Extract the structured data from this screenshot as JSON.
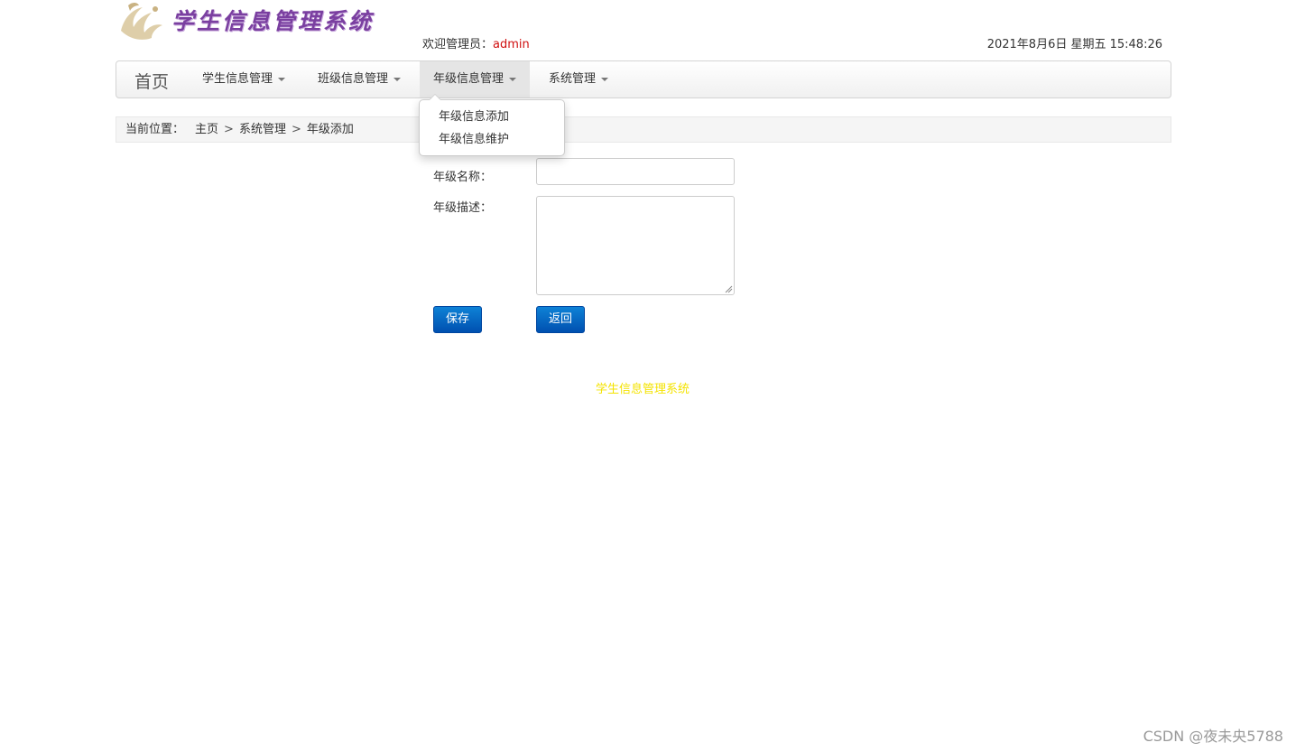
{
  "header": {
    "logo_text": "学生信息管理系统",
    "welcome_label": "欢迎管理员：",
    "welcome_user": "admin",
    "datetime": "2021年8月6日 星期五 15:48:26"
  },
  "navbar": {
    "brand": "首页",
    "items": [
      {
        "label": "学生信息管理"
      },
      {
        "label": "班级信息管理"
      },
      {
        "label": "年级信息管理"
      },
      {
        "label": "系统管理"
      }
    ],
    "active_index": 2
  },
  "dropdown": {
    "items": [
      {
        "label": "年级信息添加"
      },
      {
        "label": "年级信息维护"
      }
    ]
  },
  "breadcrumb": {
    "label": "当前位置：",
    "items": [
      "主页",
      "系统管理",
      "年级添加"
    ],
    "separator": ">"
  },
  "form": {
    "name_label": "年级名称：",
    "name_value": "",
    "desc_label": "年级描述：",
    "desc_value": "",
    "save_label": "保存",
    "back_label": "返回"
  },
  "footer": {
    "text": "学生信息管理系统"
  },
  "watermark": "CSDN @夜未央5788",
  "colors": {
    "accent_blue": "#0050b0",
    "username_red": "#d01010",
    "footer_yellow": "#f4e300",
    "logo_purple": "#7a3fa0"
  }
}
